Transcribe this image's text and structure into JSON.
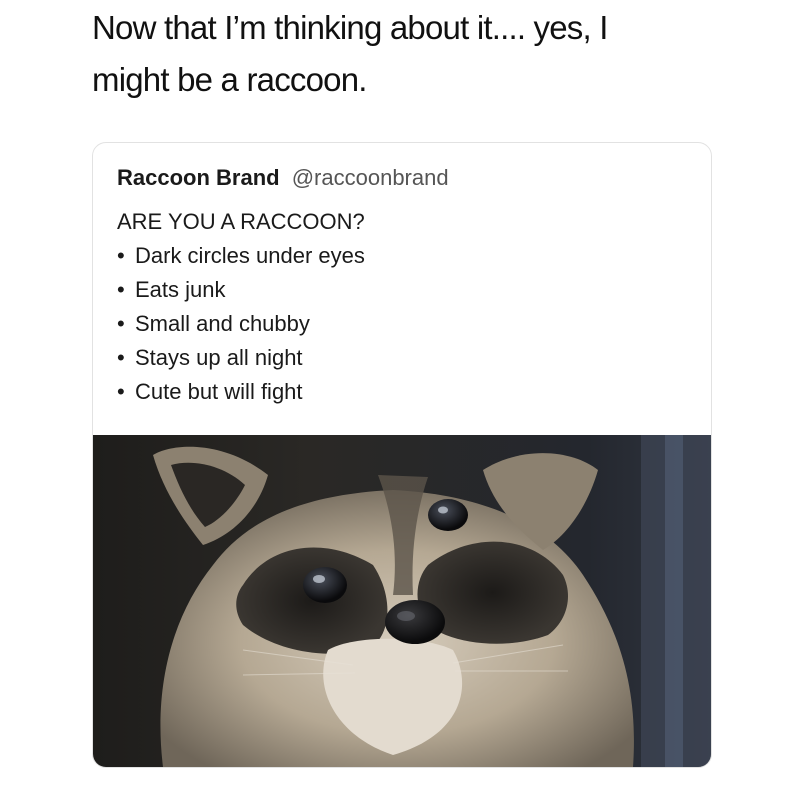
{
  "caption": {
    "line1": "Now that I’m thinking about it.... yes, I",
    "line2": "might be a raccoon."
  },
  "tweet": {
    "author_name": "Raccoon Brand",
    "author_handle": "@raccoonbrand",
    "heading": "ARE YOU A RACCOON?",
    "bullet_symbol": "•",
    "items": [
      "Dark circles under eyes",
      "Eats junk",
      "Small and chubby",
      "Stays up all night",
      "Cute but will fight"
    ]
  },
  "photo": {
    "subject": "raccoon-photo"
  },
  "colors": {
    "text": "#111111",
    "handle": "#555555",
    "card_border": "#e2e2e2"
  }
}
